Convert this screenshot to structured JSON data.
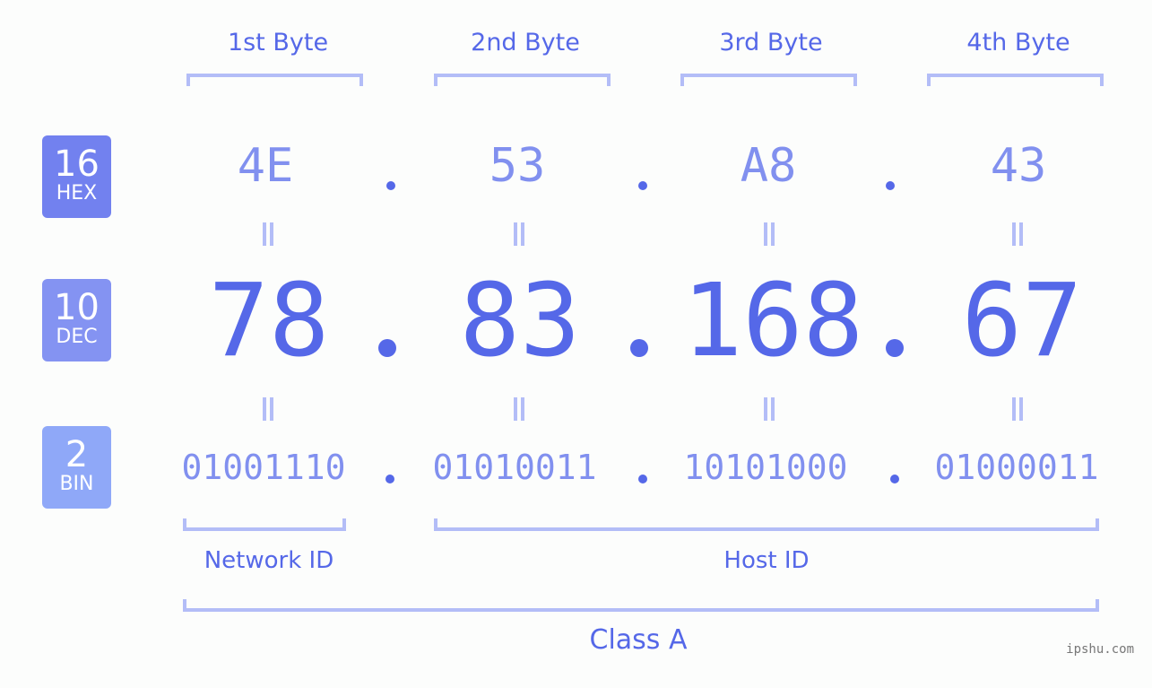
{
  "bytes": [
    {
      "label": "1st Byte",
      "hex": "4E",
      "dec": "78",
      "bin": "01001110"
    },
    {
      "label": "2nd Byte",
      "hex": "53",
      "dec": "83",
      "bin": "01010011"
    },
    {
      "label": "3rd Byte",
      "hex": "A8",
      "dec": "168",
      "bin": "10101000"
    },
    {
      "label": "4th Byte",
      "hex": "43",
      "dec": "67",
      "bin": "01000011"
    }
  ],
  "badges": {
    "hex": {
      "num": "16",
      "abbr": "HEX",
      "color": "#7281ef"
    },
    "dec": {
      "num": "10",
      "abbr": "DEC",
      "color": "#8493f2"
    },
    "bin": {
      "num": "2",
      "abbr": "BIN",
      "color": "#8fa8f8"
    }
  },
  "segments": {
    "network": "Network ID",
    "host": "Host ID",
    "class": "Class A"
  },
  "colors": {
    "primary": "#5568e8",
    "light": "#8190ef",
    "bracket": "#b3bdf7"
  },
  "watermark": "ipshu.com"
}
